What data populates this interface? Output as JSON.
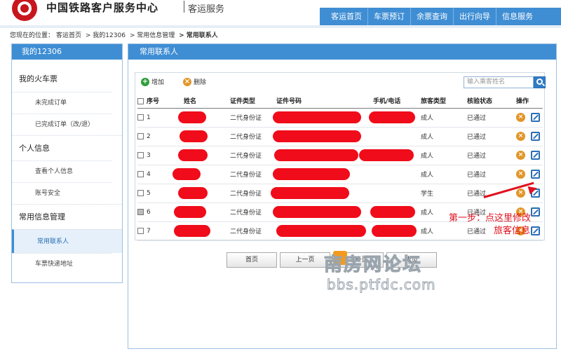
{
  "header": {
    "site_title": "中国铁路客户服务中心",
    "site_sub": "客运服务",
    "nav": [
      "客运首页",
      "车票预订",
      "余票查询",
      "出行向导",
      "信息服务"
    ]
  },
  "breadcrumb": {
    "prefix": "您现在的位置：",
    "items": [
      "客运首页",
      "> 我的12306",
      "> 常用信息管理",
      "> 常用联系人"
    ]
  },
  "sidebar": {
    "title": "我的12306",
    "sections": [
      {
        "label": "我的火车票",
        "items": [
          "未完成订单",
          "已完成订单（改/退）"
        ]
      },
      {
        "label": "个人信息",
        "items": [
          "查看个人信息",
          "账号安全"
        ]
      },
      {
        "label": "常用信息管理",
        "items": [
          "常用联系人",
          "车票快递地址"
        ]
      }
    ],
    "active_item": "常用联系人"
  },
  "main": {
    "title": "常用联系人",
    "toolbar": {
      "add_label": "增加",
      "delete_label": "删除",
      "search_placeholder": "输入乘客姓名"
    },
    "table": {
      "headers": [
        "序号",
        "姓名",
        "证件类型",
        "证件号码",
        "手机/电话",
        "旅客类型",
        "核验状态",
        "操作"
      ],
      "rows": [
        {
          "no": "1",
          "id_type": "二代身份证",
          "passenger_type": "成人",
          "status": "已通过"
        },
        {
          "no": "2",
          "id_type": "二代身份证",
          "passenger_type": "成人",
          "status": "已通过"
        },
        {
          "no": "3",
          "id_type": "二代身份证",
          "passenger_type": "成人",
          "status": "已通过"
        },
        {
          "no": "4",
          "id_type": "二代身份证",
          "passenger_type": "成人",
          "status": "已通过"
        },
        {
          "no": "5",
          "id_type": "二代身份证",
          "passenger_type": "学生",
          "status": "已通过"
        },
        {
          "no": "6",
          "id_type": "二代身份证",
          "passenger_type": "成人",
          "status": "已通过"
        },
        {
          "no": "7",
          "id_type": "二代身份证",
          "passenger_type": "成人",
          "status": "已通过"
        }
      ]
    },
    "pager": [
      "首页",
      "上一页",
      "下一页",
      "末页"
    ]
  },
  "annotation": {
    "line1": "第一步：点这里修改",
    "line2": "旅客信息"
  },
  "watermark": {
    "line1": "南房网论坛",
    "line2": "bbs.ptfdc.com"
  },
  "colors": {
    "accent": "#3f8ed4",
    "redaction": "#f00c1a",
    "annotation": "#e0101f"
  }
}
